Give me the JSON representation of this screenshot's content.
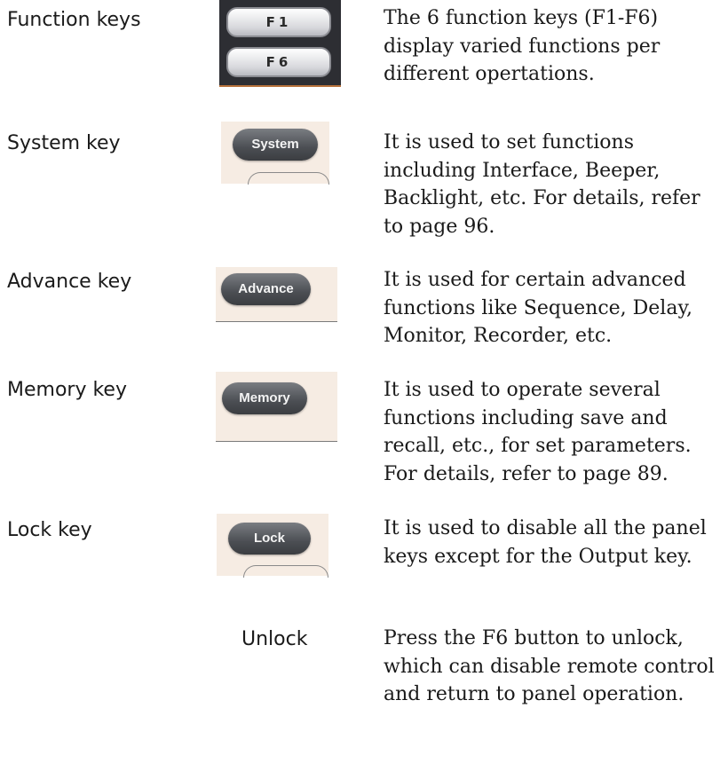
{
  "rows": [
    {
      "label": "Function keys",
      "key_labels": [
        "F1",
        "F6"
      ],
      "description": "The 6 function keys (F1-F6) display varied functions per different opertations."
    },
    {
      "label": "System key",
      "key_label": "System",
      "description": "It is used to set functions including Interface, Beeper, Backlight, etc. For details, refer to page 96."
    },
    {
      "label": "Advance key",
      "key_label": "Advance",
      "description": "It is used for certain advanced functions like Sequence, Delay, Monitor, Recorder, etc."
    },
    {
      "label": "Memory key",
      "key_label": "Memory",
      "description": "It is used to operate several functions including save and recall, etc., for set parameters. For details, refer to page 89."
    },
    {
      "label": "Lock key",
      "key_label": "Lock",
      "description": "It is used to disable all the panel keys except for the Output key."
    }
  ],
  "unlock": {
    "label": "Unlock",
    "description": "Press the F6 button to unlock, which can disable remote control and return to panel operation."
  }
}
